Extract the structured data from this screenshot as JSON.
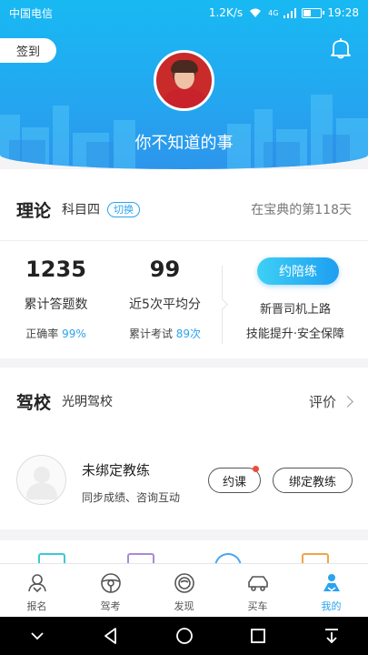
{
  "status_bar": {
    "carrier": "中国电信",
    "speed": "1.2K/s",
    "network": "4G",
    "time": "19:28"
  },
  "header": {
    "checkin_label": "签到",
    "username": "你不知道的事"
  },
  "theory": {
    "title": "理论",
    "subject": "科目四",
    "switch_label": "切换",
    "days_text": "在宝典的第118天",
    "answered_count": "1235",
    "answered_label": "累计答题数",
    "accuracy_label": "正确率",
    "accuracy_value": "99%",
    "avg_score": "99",
    "avg_label": "近5次平均分",
    "exam_label": "累计考试",
    "exam_value": "89次",
    "accompany_button": "约陪练",
    "promo_line1": "新晋司机上路",
    "promo_line2": "技能提升·安全保障"
  },
  "school": {
    "title": "驾校",
    "name": "光明驾校",
    "rate_label": "评价",
    "coach_status": "未绑定教练",
    "coach_desc": "同步成绩、咨询互动",
    "book_button": "约课",
    "bind_button": "绑定教练"
  },
  "tabs": [
    {
      "label": "报名",
      "icon": "signup-icon"
    },
    {
      "label": "驾考",
      "icon": "steering-wheel-icon"
    },
    {
      "label": "发现",
      "icon": "discover-icon"
    },
    {
      "label": "买车",
      "icon": "car-icon"
    },
    {
      "label": "我的",
      "icon": "profile-icon",
      "active": true
    }
  ],
  "colors": {
    "accent": "#2aa3f0",
    "header_top": "#18b9f3",
    "header_bottom": "#2d95ec",
    "badge_red": "#f24b3b"
  }
}
